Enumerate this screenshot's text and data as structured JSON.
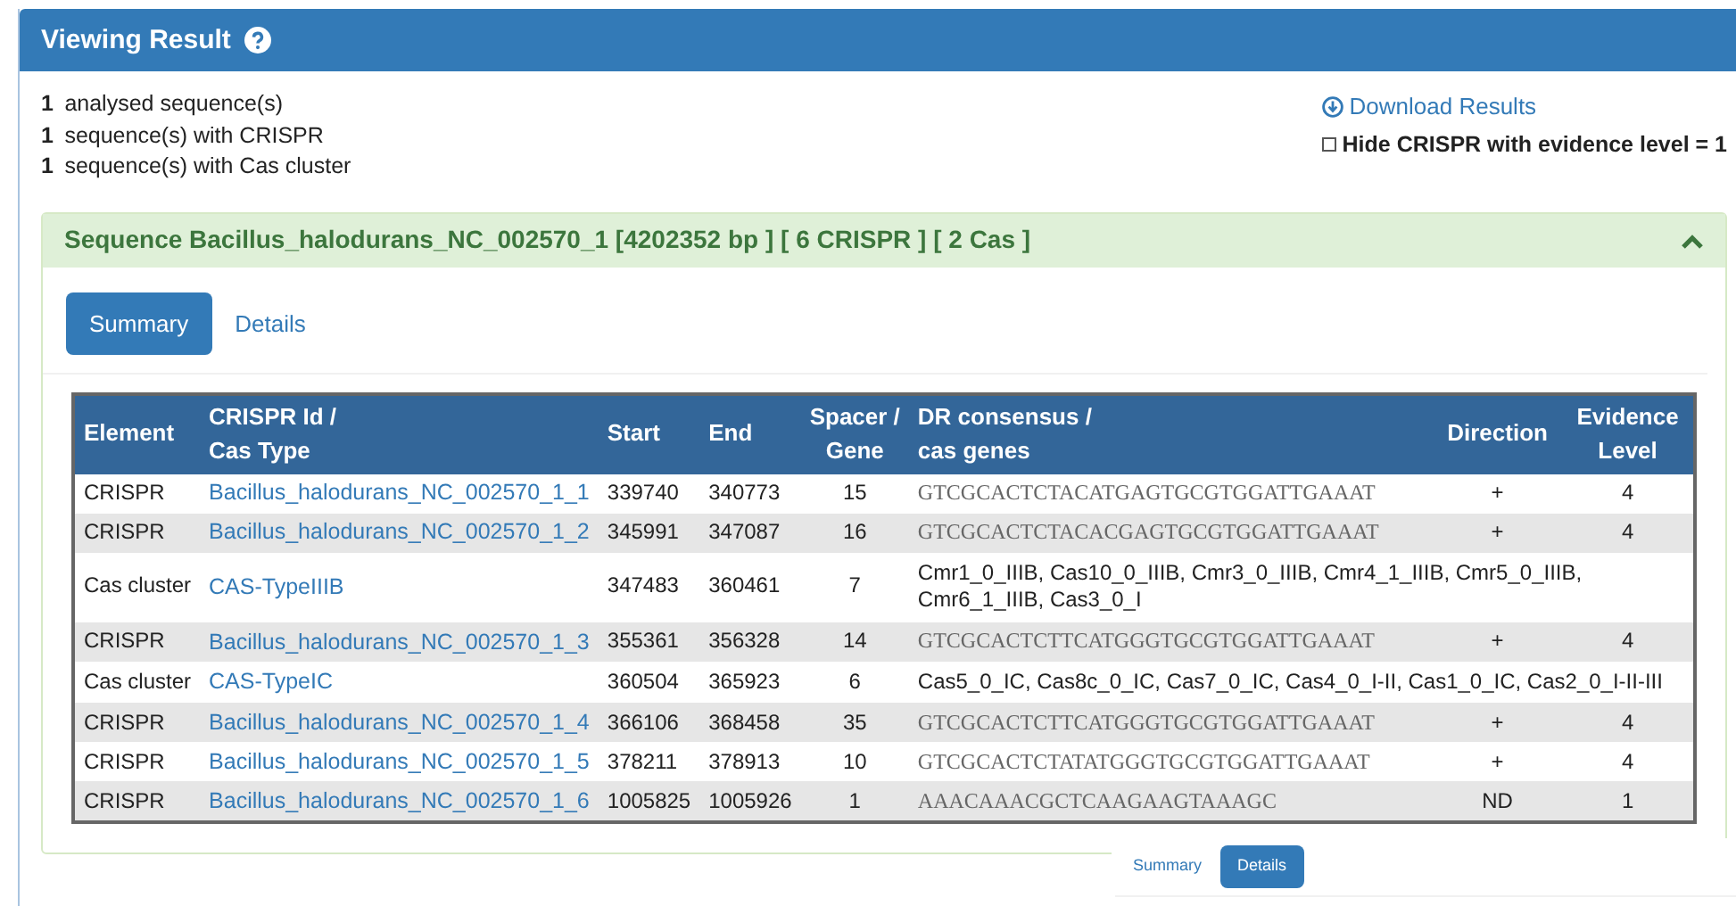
{
  "header": {
    "title": "Viewing Result"
  },
  "stats": [
    {
      "count": "1",
      "label": "analysed sequence(s)"
    },
    {
      "count": "1",
      "label": "sequence(s) with CRISPR"
    },
    {
      "count": "1",
      "label": "sequence(s) with Cas cluster"
    }
  ],
  "download": {
    "label": "Download Results"
  },
  "hide_option": {
    "label": "Hide CRISPR with evidence level = 1",
    "checked": false
  },
  "sequence": {
    "title": "Sequence Bacillus_halodurans_NC_002570_1 [4202352 bp ] [ 6 CRISPR ] [ 2 Cas ]",
    "expanded": true,
    "tabs": [
      {
        "label": "Summary",
        "selected": true
      },
      {
        "label": "Details",
        "selected": false
      }
    ],
    "table": {
      "columns": [
        {
          "lines": [
            "Element"
          ]
        },
        {
          "lines": [
            "CRISPR Id /",
            "Cas Type"
          ]
        },
        {
          "lines": [
            "Start"
          ]
        },
        {
          "lines": [
            "End"
          ]
        },
        {
          "lines": [
            "Spacer /",
            "Gene"
          ]
        },
        {
          "lines": [
            "DR consensus /",
            "cas genes"
          ]
        },
        {
          "lines": [
            "Direction"
          ]
        },
        {
          "lines": [
            "Evidence",
            "Level"
          ]
        }
      ],
      "rows": [
        {
          "kind": "crispr",
          "element": "CRISPR",
          "id": "Bacillus_halodurans_NC_002570_1_1",
          "start": "339740",
          "end": "340773",
          "count": "15",
          "sequence": "GTCGCACTCTACATGAGTGCGTGGATTGAAAT",
          "direction": "+",
          "evidence": "4"
        },
        {
          "kind": "crispr",
          "element": "CRISPR",
          "id": "Bacillus_halodurans_NC_002570_1_2",
          "start": "345991",
          "end": "347087",
          "count": "16",
          "sequence": "GTCGCACTCTACACGAGTGCGTGGATTGAAAT",
          "direction": "+",
          "evidence": "4"
        },
        {
          "kind": "cas",
          "element": "Cas cluster",
          "id": "CAS-TypeIIIB",
          "start": "347483",
          "end": "360461",
          "count": "7",
          "sequence": "Cmr1_0_IIIB, Cas10_0_IIIB, Cmr3_0_IIIB, Cmr4_1_IIIB, Cmr5_0_IIIB, Cmr6_1_IIIB, Cas3_0_I"
        },
        {
          "kind": "crispr",
          "element": "CRISPR",
          "id": "Bacillus_halodurans_NC_002570_1_3",
          "start": "355361",
          "end": "356328",
          "count": "14",
          "sequence": "GTCGCACTCTTCATGGGTGCGTGGATTGAAAT",
          "direction": "+",
          "evidence": "4"
        },
        {
          "kind": "cas",
          "element": "Cas cluster",
          "id": "CAS-TypeIC",
          "start": "360504",
          "end": "365923",
          "count": "6",
          "sequence": "Cas5_0_IC, Cas8c_0_IC, Cas7_0_IC, Cas4_0_I-II, Cas1_0_IC, Cas2_0_I-II-III"
        },
        {
          "kind": "crispr",
          "element": "CRISPR",
          "id": "Bacillus_halodurans_NC_002570_1_4",
          "start": "366106",
          "end": "368458",
          "count": "35",
          "sequence": "GTCGCACTCTTCATGGGTGCGTGGATTGAAAT",
          "direction": "+",
          "evidence": "4"
        },
        {
          "kind": "crispr",
          "element": "CRISPR",
          "id": "Bacillus_halodurans_NC_002570_1_5",
          "start": "378211",
          "end": "378913",
          "count": "10",
          "sequence": "GTCGCACTCTATATGGGTGCGTGGATTGAAAT",
          "direction": "+",
          "evidence": "4"
        },
        {
          "kind": "crispr",
          "element": "CRISPR",
          "id": "Bacillus_halodurans_NC_002570_1_6",
          "start": "1005825",
          "end": "1005926",
          "count": "1",
          "sequence": "AAACAAACGCTCAAGAAGTAAAGC",
          "direction": "ND",
          "evidence": "1"
        }
      ]
    }
  },
  "overlay": {
    "tabs": [
      {
        "label": "Summary",
        "selected": false
      },
      {
        "label": "Details",
        "selected": true
      }
    ]
  }
}
